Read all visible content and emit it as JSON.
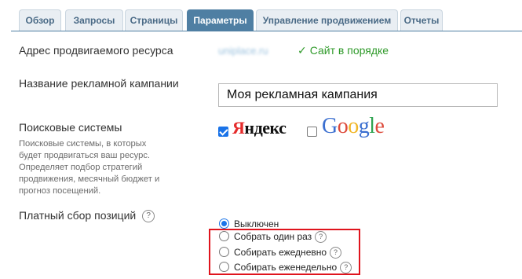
{
  "tabs": [
    {
      "label": "Обзор"
    },
    {
      "label": "Запросы"
    },
    {
      "label": "Страницы"
    },
    {
      "label": "Параметры",
      "active": true
    },
    {
      "label": "Управление продвижением"
    },
    {
      "label": "Отчеты"
    }
  ],
  "site": {
    "label": "Адрес продвигаемого ресурса",
    "url": "uniplace.ru",
    "status_icon": "check-icon",
    "status": "Сайт в порядке",
    "status_color": "#2f9a2a"
  },
  "campaign": {
    "label": "Название рекламной кампании",
    "value": "Моя рекламная кампания"
  },
  "search_engines": {
    "label": "Поисковые системы",
    "hint": "Поисковые системы, в которых будет продвигаться ваш ресурс. Определяет подбор стратегий продвижения, месячный бюджет и прогноз посещений.",
    "yandex": {
      "brand": "Яндекс",
      "checked": true
    },
    "google": {
      "brand": "Google",
      "checked": false
    }
  },
  "paid_positions": {
    "label": "Платный сбор позиций",
    "help_icon": "question-icon",
    "options": [
      {
        "label": "Выключен",
        "selected": true
      },
      {
        "label": "Собрать один раз",
        "selected": false
      },
      {
        "label": "Собирать ежедневно",
        "selected": false
      },
      {
        "label": "Собирать еженедельно",
        "selected": false
      }
    ]
  },
  "colors": {
    "accent": "#4f7fa3",
    "highlight": "#e0141d",
    "checkbox": "#1a73e8"
  }
}
